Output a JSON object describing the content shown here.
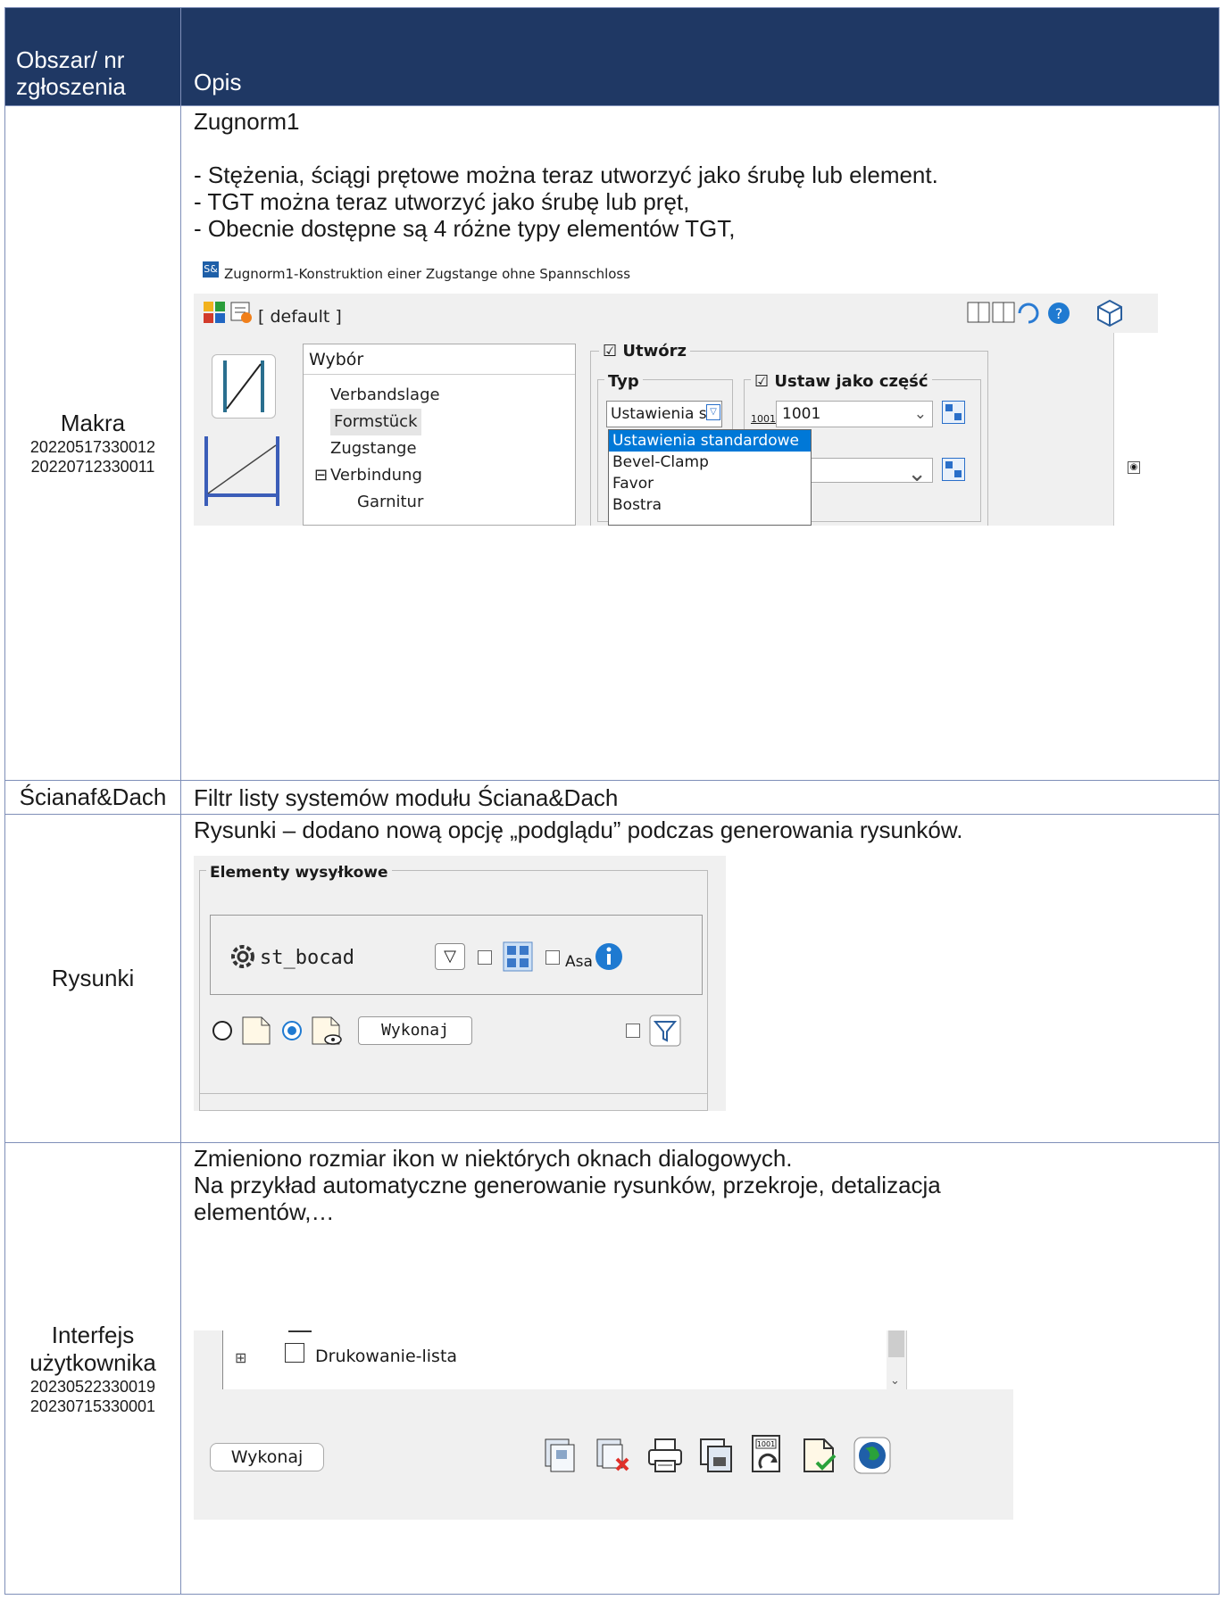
{
  "header": {
    "area": "Obszar/ nr zgłoszenia",
    "area_l1": "Obszar/ nr",
    "area_l2": "zgłoszenia",
    "desc": "Opis"
  },
  "rows": [
    {
      "area": "Makra",
      "codes": [
        "20220517330012",
        "20220712330011"
      ],
      "title": "Zugnorm1",
      "bullets": [
        "- Stężenia, ściągi prętowe można teraz utworzyć jako śrubę lub element.",
        "- TGT można teraz utworzyć jako śrubę lub pręt,",
        "- Obecnie dostępne są 4 różne typy elementów TGT,"
      ],
      "dialog": {
        "app_badge": "S&",
        "window_title": "Zugnorm1-Konstruktion einer Zugstange ohne Spannschloss",
        "profile": "[ default ]",
        "tree_header": "Wybór",
        "tree_items": [
          "Verbandslage",
          "Formstück",
          "Zugstange",
          "Verbindung",
          "Garnitur"
        ],
        "create_label": "Utwórz",
        "type_label": "Typ",
        "set_as_part_label": "Ustaw jako część",
        "type_value": "Ustawienia st",
        "part_number": "1001",
        "dropdown_options": [
          "Ustawienia standardowe",
          "Bevel-Clamp",
          "Favor",
          "Bostra"
        ]
      }
    },
    {
      "area": "Ścianaf&Dach",
      "desc": "Filtr listy systemów modułu Ściana&Dach"
    },
    {
      "area": "Rysunki",
      "desc": "Rysunki – dodano nową opcję „podglądu” podczas generowania rysunków.",
      "panel": {
        "group_title": "Elementy wysyłkowe",
        "config_name": "st_bocad",
        "asa_label": "Asa",
        "execute": "Wykonaj"
      }
    },
    {
      "area_l1": "Interfejs",
      "area_l2": "użytkownika",
      "codes": [
        "20230522330019",
        "20230715330001"
      ],
      "desc_lines": [
        "Zmieniono rozmiar ikon w niektórych oknach dialogowych.",
        "Na przykład automatyczne generowanie rysunków, przekroje, detalizacja",
        "elementów,…"
      ],
      "panel": {
        "tree_item": "Drukowanie-lista",
        "execute": "Wykonaj"
      }
    }
  ],
  "colors": {
    "header_bg": "#1f3864",
    "border": "#7f8fb8",
    "highlight": "#0078d7"
  }
}
